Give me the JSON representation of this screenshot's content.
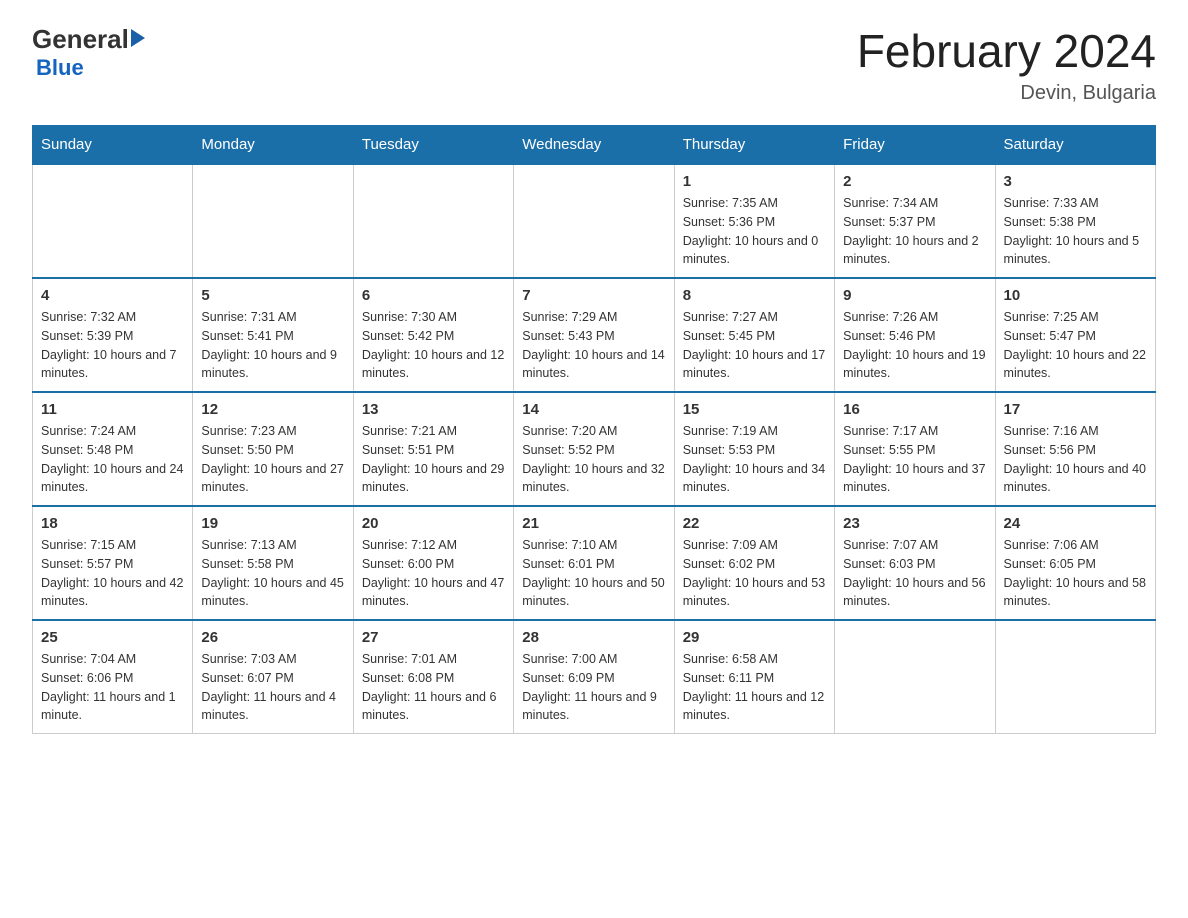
{
  "logo": {
    "general": "General",
    "blue": "Blue"
  },
  "title": "February 2024",
  "location": "Devin, Bulgaria",
  "days_of_week": [
    "Sunday",
    "Monday",
    "Tuesday",
    "Wednesday",
    "Thursday",
    "Friday",
    "Saturday"
  ],
  "weeks": [
    [
      {
        "day": "",
        "info": ""
      },
      {
        "day": "",
        "info": ""
      },
      {
        "day": "",
        "info": ""
      },
      {
        "day": "",
        "info": ""
      },
      {
        "day": "1",
        "info": "Sunrise: 7:35 AM\nSunset: 5:36 PM\nDaylight: 10 hours and 0 minutes."
      },
      {
        "day": "2",
        "info": "Sunrise: 7:34 AM\nSunset: 5:37 PM\nDaylight: 10 hours and 2 minutes."
      },
      {
        "day": "3",
        "info": "Sunrise: 7:33 AM\nSunset: 5:38 PM\nDaylight: 10 hours and 5 minutes."
      }
    ],
    [
      {
        "day": "4",
        "info": "Sunrise: 7:32 AM\nSunset: 5:39 PM\nDaylight: 10 hours and 7 minutes."
      },
      {
        "day": "5",
        "info": "Sunrise: 7:31 AM\nSunset: 5:41 PM\nDaylight: 10 hours and 9 minutes."
      },
      {
        "day": "6",
        "info": "Sunrise: 7:30 AM\nSunset: 5:42 PM\nDaylight: 10 hours and 12 minutes."
      },
      {
        "day": "7",
        "info": "Sunrise: 7:29 AM\nSunset: 5:43 PM\nDaylight: 10 hours and 14 minutes."
      },
      {
        "day": "8",
        "info": "Sunrise: 7:27 AM\nSunset: 5:45 PM\nDaylight: 10 hours and 17 minutes."
      },
      {
        "day": "9",
        "info": "Sunrise: 7:26 AM\nSunset: 5:46 PM\nDaylight: 10 hours and 19 minutes."
      },
      {
        "day": "10",
        "info": "Sunrise: 7:25 AM\nSunset: 5:47 PM\nDaylight: 10 hours and 22 minutes."
      }
    ],
    [
      {
        "day": "11",
        "info": "Sunrise: 7:24 AM\nSunset: 5:48 PM\nDaylight: 10 hours and 24 minutes."
      },
      {
        "day": "12",
        "info": "Sunrise: 7:23 AM\nSunset: 5:50 PM\nDaylight: 10 hours and 27 minutes."
      },
      {
        "day": "13",
        "info": "Sunrise: 7:21 AM\nSunset: 5:51 PM\nDaylight: 10 hours and 29 minutes."
      },
      {
        "day": "14",
        "info": "Sunrise: 7:20 AM\nSunset: 5:52 PM\nDaylight: 10 hours and 32 minutes."
      },
      {
        "day": "15",
        "info": "Sunrise: 7:19 AM\nSunset: 5:53 PM\nDaylight: 10 hours and 34 minutes."
      },
      {
        "day": "16",
        "info": "Sunrise: 7:17 AM\nSunset: 5:55 PM\nDaylight: 10 hours and 37 minutes."
      },
      {
        "day": "17",
        "info": "Sunrise: 7:16 AM\nSunset: 5:56 PM\nDaylight: 10 hours and 40 minutes."
      }
    ],
    [
      {
        "day": "18",
        "info": "Sunrise: 7:15 AM\nSunset: 5:57 PM\nDaylight: 10 hours and 42 minutes."
      },
      {
        "day": "19",
        "info": "Sunrise: 7:13 AM\nSunset: 5:58 PM\nDaylight: 10 hours and 45 minutes."
      },
      {
        "day": "20",
        "info": "Sunrise: 7:12 AM\nSunset: 6:00 PM\nDaylight: 10 hours and 47 minutes."
      },
      {
        "day": "21",
        "info": "Sunrise: 7:10 AM\nSunset: 6:01 PM\nDaylight: 10 hours and 50 minutes."
      },
      {
        "day": "22",
        "info": "Sunrise: 7:09 AM\nSunset: 6:02 PM\nDaylight: 10 hours and 53 minutes."
      },
      {
        "day": "23",
        "info": "Sunrise: 7:07 AM\nSunset: 6:03 PM\nDaylight: 10 hours and 56 minutes."
      },
      {
        "day": "24",
        "info": "Sunrise: 7:06 AM\nSunset: 6:05 PM\nDaylight: 10 hours and 58 minutes."
      }
    ],
    [
      {
        "day": "25",
        "info": "Sunrise: 7:04 AM\nSunset: 6:06 PM\nDaylight: 11 hours and 1 minute."
      },
      {
        "day": "26",
        "info": "Sunrise: 7:03 AM\nSunset: 6:07 PM\nDaylight: 11 hours and 4 minutes."
      },
      {
        "day": "27",
        "info": "Sunrise: 7:01 AM\nSunset: 6:08 PM\nDaylight: 11 hours and 6 minutes."
      },
      {
        "day": "28",
        "info": "Sunrise: 7:00 AM\nSunset: 6:09 PM\nDaylight: 11 hours and 9 minutes."
      },
      {
        "day": "29",
        "info": "Sunrise: 6:58 AM\nSunset: 6:11 PM\nDaylight: 11 hours and 12 minutes."
      },
      {
        "day": "",
        "info": ""
      },
      {
        "day": "",
        "info": ""
      }
    ]
  ]
}
